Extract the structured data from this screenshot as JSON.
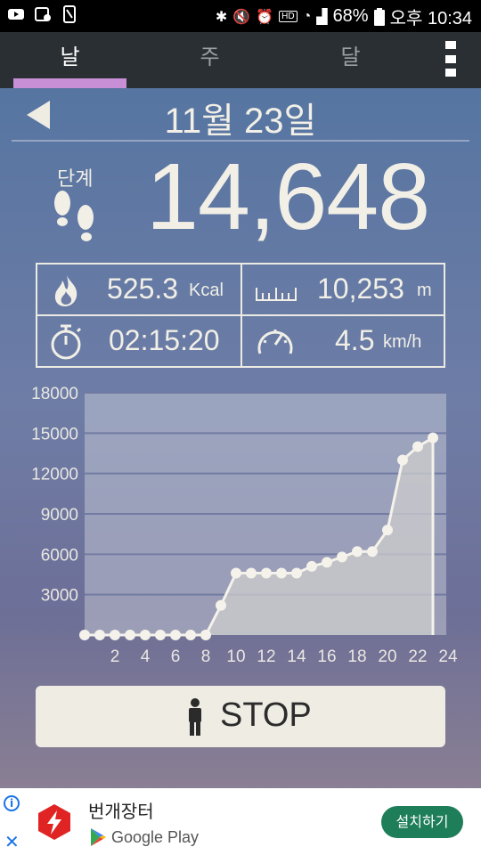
{
  "status_bar": {
    "battery": "68%",
    "time": "오후 10:34",
    "hd": "HD"
  },
  "tabs": [
    {
      "label": "날",
      "active": true
    },
    {
      "label": "주",
      "active": false
    },
    {
      "label": "달",
      "active": false
    }
  ],
  "date": "11월 23일",
  "steps": {
    "label": "단계",
    "value": "14,648"
  },
  "stats": {
    "calories": {
      "value": "525.3",
      "unit": "Kcal"
    },
    "distance": {
      "value": "10,253",
      "unit": "m"
    },
    "duration": {
      "value": "02:15:20"
    },
    "speed": {
      "value": "4.5",
      "unit": "km/h"
    }
  },
  "colors": {
    "accent_tab": "#c98fd6",
    "text_light": "#f1efe6",
    "install_button": "#1f7e5a"
  },
  "chart_data": {
    "type": "area",
    "x": [
      0,
      1,
      2,
      3,
      4,
      5,
      6,
      7,
      8,
      9,
      10,
      11,
      12,
      13,
      14,
      15,
      16,
      17,
      18,
      19,
      20,
      21,
      22,
      23
    ],
    "values": [
      0,
      0,
      0,
      0,
      0,
      0,
      0,
      0,
      0,
      2200,
      4600,
      4600,
      4600,
      4600,
      4600,
      5100,
      5400,
      5800,
      6200,
      6200,
      7800,
      13000,
      14000,
      14648
    ],
    "x_ticks": [
      "2",
      "4",
      "6",
      "8",
      "10",
      "12",
      "14",
      "16",
      "18",
      "20",
      "22",
      "24"
    ],
    "y_ticks": [
      "18000",
      "15000",
      "12000",
      "9000",
      "6000",
      "3000"
    ],
    "xlim": [
      0,
      24
    ],
    "ylim": [
      0,
      18000
    ],
    "grid": true
  },
  "stop_button": {
    "label": "STOP"
  },
  "ad": {
    "title": "번개장터",
    "store": "Google Play",
    "install": "설치하기"
  }
}
